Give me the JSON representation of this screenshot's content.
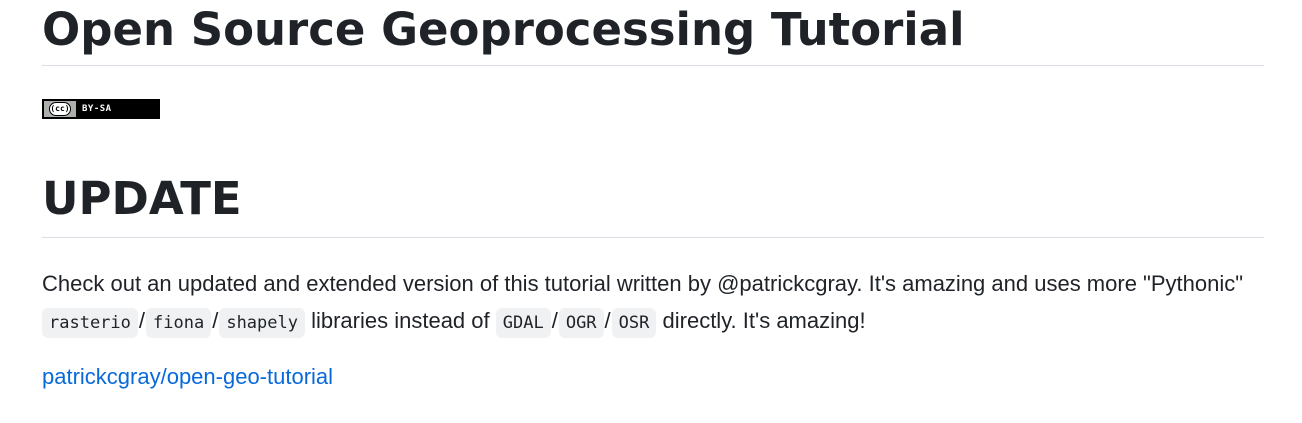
{
  "title": "Open Source Geoprocessing Tutorial",
  "license_badge": {
    "left_text": "(cc)",
    "right_text": "BY-SA"
  },
  "update_heading": "UPDATE",
  "paragraph": {
    "part1": "Check out an updated and extended version of this tutorial written by @patrickcgray. It's amazing and uses more \"Pythonic\" ",
    "code1": "rasterio",
    "sep1": "/",
    "code2": "fiona",
    "sep2": "/",
    "code3": "shapely",
    "part2": " libraries instead of ",
    "code4": "GDAL",
    "sep3": "/",
    "code5": "OGR",
    "sep4": "/",
    "code6": "OSR",
    "part3": " directly. It's amazing!"
  },
  "link": {
    "text": "patrickcgray/open-geo-tutorial"
  },
  "colors": {
    "link": "#0969da",
    "text": "#1f2328",
    "divider": "#d8dee4",
    "code_bg": "#eff1f3"
  }
}
